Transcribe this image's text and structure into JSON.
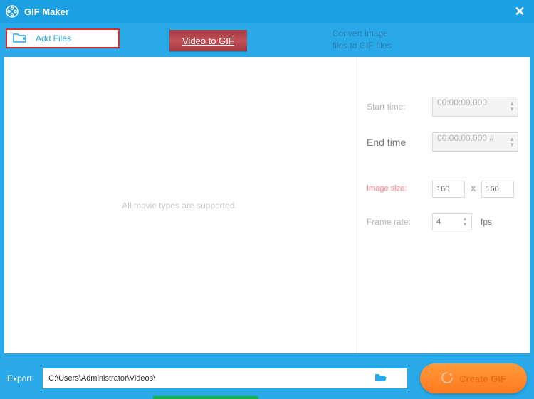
{
  "window": {
    "title": "GIF Maker"
  },
  "tabs": {
    "add_files_label": "Add Files",
    "video_to_gif_label": "Video to GIF",
    "convert_line1": "Convert image",
    "convert_line2": "files to GIF files"
  },
  "left_panel": {
    "placeholder": "All movie types are supported."
  },
  "right_panel": {
    "start_time_label": "Start time:",
    "start_time_value": "00:00:00.000",
    "end_time_label": "End time",
    "end_time_value": "00:00:00.000 #",
    "image_size_label": "Image size:",
    "width_value": "160",
    "height_value": "160",
    "x_sep": "X",
    "frame_rate_label": "Frame rate:",
    "frame_rate_value": "4",
    "fps_label": "fps"
  },
  "footer": {
    "export_label": "Export:",
    "export_path": "C:\\Users\\Administrator\\Videos\\",
    "create_label": "Create GIF"
  }
}
